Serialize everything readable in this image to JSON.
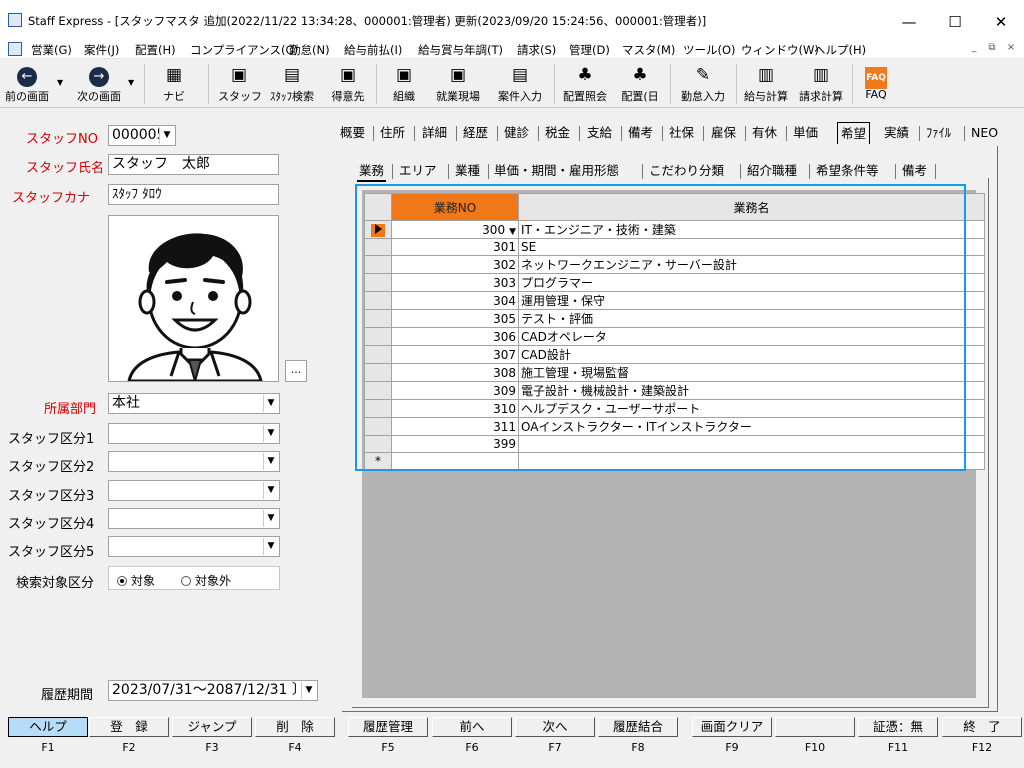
{
  "window": {
    "title": "Staff Express - [スタッフマスタ 追加(2022/11/22 13:34:28、000001:管理者) 更新(2023/09/20 15:24:56、000001:管理者)]",
    "minimize": "—",
    "maximize": "☐",
    "close": "✕"
  },
  "menu": {
    "items": [
      "営業(G)",
      "案件(J)",
      "配置(H)",
      "コンプライアンス(C)",
      "勤怠(N)",
      "給与前払(I)",
      "給与賞与年調(T)",
      "請求(S)",
      "管理(D)",
      "マスタ(M)",
      "ツール(O)",
      "ウィンドウ(W)",
      "ヘルプ(H)"
    ],
    "mdi_min": "_",
    "mdi_restore": "⧉",
    "mdi_close": "×"
  },
  "toolbar": {
    "items": [
      {
        "label": "前の画面",
        "icon": "back-arrow-icon",
        "glyph": "←"
      },
      {
        "label": "次の画面",
        "icon": "forward-arrow-icon",
        "glyph": "→"
      },
      {
        "label": "ナビ",
        "icon": "navi-screen-icon",
        "glyph": "▦"
      },
      {
        "label": "スタッフ",
        "icon": "staff-icon",
        "glyph": "▣"
      },
      {
        "label": "ｽﾀｯﾌ検索",
        "icon": "staff-search-icon",
        "glyph": "▤"
      },
      {
        "label": "得意先",
        "icon": "client-icon",
        "glyph": "▣"
      },
      {
        "label": "組織",
        "icon": "organization-icon",
        "glyph": "▣"
      },
      {
        "label": "就業現場",
        "icon": "worksite-icon",
        "glyph": "▣"
      },
      {
        "label": "案件入力",
        "icon": "project-input-icon",
        "glyph": "▤"
      },
      {
        "label": "配置照会",
        "icon": "assignment-inquiry-icon",
        "glyph": "♣"
      },
      {
        "label": "配置(日",
        "icon": "assignment-daily-icon",
        "glyph": "♣"
      },
      {
        "label": "勤怠入力",
        "icon": "attendance-input-icon",
        "glyph": "✎"
      },
      {
        "label": "給与計算",
        "icon": "payroll-icon",
        "glyph": "▥"
      },
      {
        "label": "請求計算",
        "icon": "billing-icon",
        "glyph": "▥"
      },
      {
        "label": "FAQ",
        "icon": "faq-icon",
        "glyph": "FAQ"
      }
    ]
  },
  "form": {
    "staff_no_label": "スタッフNO",
    "staff_no": "000005",
    "staff_name_label": "スタッフ氏名",
    "staff_name": "スタッフ　太郎",
    "staff_kana_label": "スタッフカナ",
    "staff_kana": "ｽﾀｯﾌ ﾀﾛｳ",
    "ellipsis": "...",
    "dept_label": "所属部門",
    "dept": "本社",
    "cat_labels": [
      "スタッフ区分1",
      "スタッフ区分2",
      "スタッフ区分3",
      "スタッフ区分4",
      "スタッフ区分5"
    ],
    "search_target_label": "検索対象区分",
    "radio_target": "対象",
    "radio_exclude": "対象外",
    "history_label": "履歴期間",
    "history_value": "2023/07/31～2087/12/31 〕"
  },
  "main_tabs": [
    "概要",
    "住所",
    "詳細",
    "経歴",
    "健診",
    "税金",
    "支給",
    "備考",
    "社保",
    "雇保",
    "有休",
    "単価",
    "希望",
    "実績",
    "ﾌｧｲﾙ",
    "NEO"
  ],
  "main_tab_active": "希望",
  "sub_tabs": [
    "業務",
    "エリア",
    "業種",
    "単価・期間・雇用形態",
    "こだわり分類",
    "紹介職種",
    "希望条件等",
    "備考"
  ],
  "sub_tab_active": "業務",
  "grid": {
    "col_no": "業務NO",
    "col_name": "業務名",
    "new_row_marker": "*",
    "rows": [
      {
        "no": "300",
        "name": "IT・エンジニア・技術・建築"
      },
      {
        "no": "301",
        "name": "SE"
      },
      {
        "no": "302",
        "name": "ネットワークエンジニア・サーバー設計"
      },
      {
        "no": "303",
        "name": "プログラマー"
      },
      {
        "no": "304",
        "name": "運用管理・保守"
      },
      {
        "no": "305",
        "name": "テスト・評価"
      },
      {
        "no": "306",
        "name": "CADオペレータ"
      },
      {
        "no": "307",
        "name": "CAD設計"
      },
      {
        "no": "308",
        "name": "施工管理・現場監督"
      },
      {
        "no": "309",
        "name": "電子設計・機械設計・建築設計"
      },
      {
        "no": "310",
        "name": "ヘルプデスク・ユーザーサポート"
      },
      {
        "no": "311",
        "name": "OAインストラクター・ITインストラクター"
      },
      {
        "no": "399",
        "name": ""
      }
    ]
  },
  "fkeys": [
    {
      "label": "ヘルプ",
      "key": "F1"
    },
    {
      "label": "登　録",
      "key": "F2"
    },
    {
      "label": "ジャンプ",
      "key": "F3"
    },
    {
      "label": "削　除",
      "key": "F4"
    },
    {
      "label": "履歴管理",
      "key": "F5"
    },
    {
      "label": "前へ",
      "key": "F6"
    },
    {
      "label": "次へ",
      "key": "F7"
    },
    {
      "label": "履歴結合",
      "key": "F8"
    },
    {
      "label": "画面クリア",
      "key": "F9"
    },
    {
      "label": "",
      "key": "F10"
    },
    {
      "label": "証憑：無",
      "key": "F11"
    },
    {
      "label": "終　了",
      "key": "F12"
    }
  ]
}
